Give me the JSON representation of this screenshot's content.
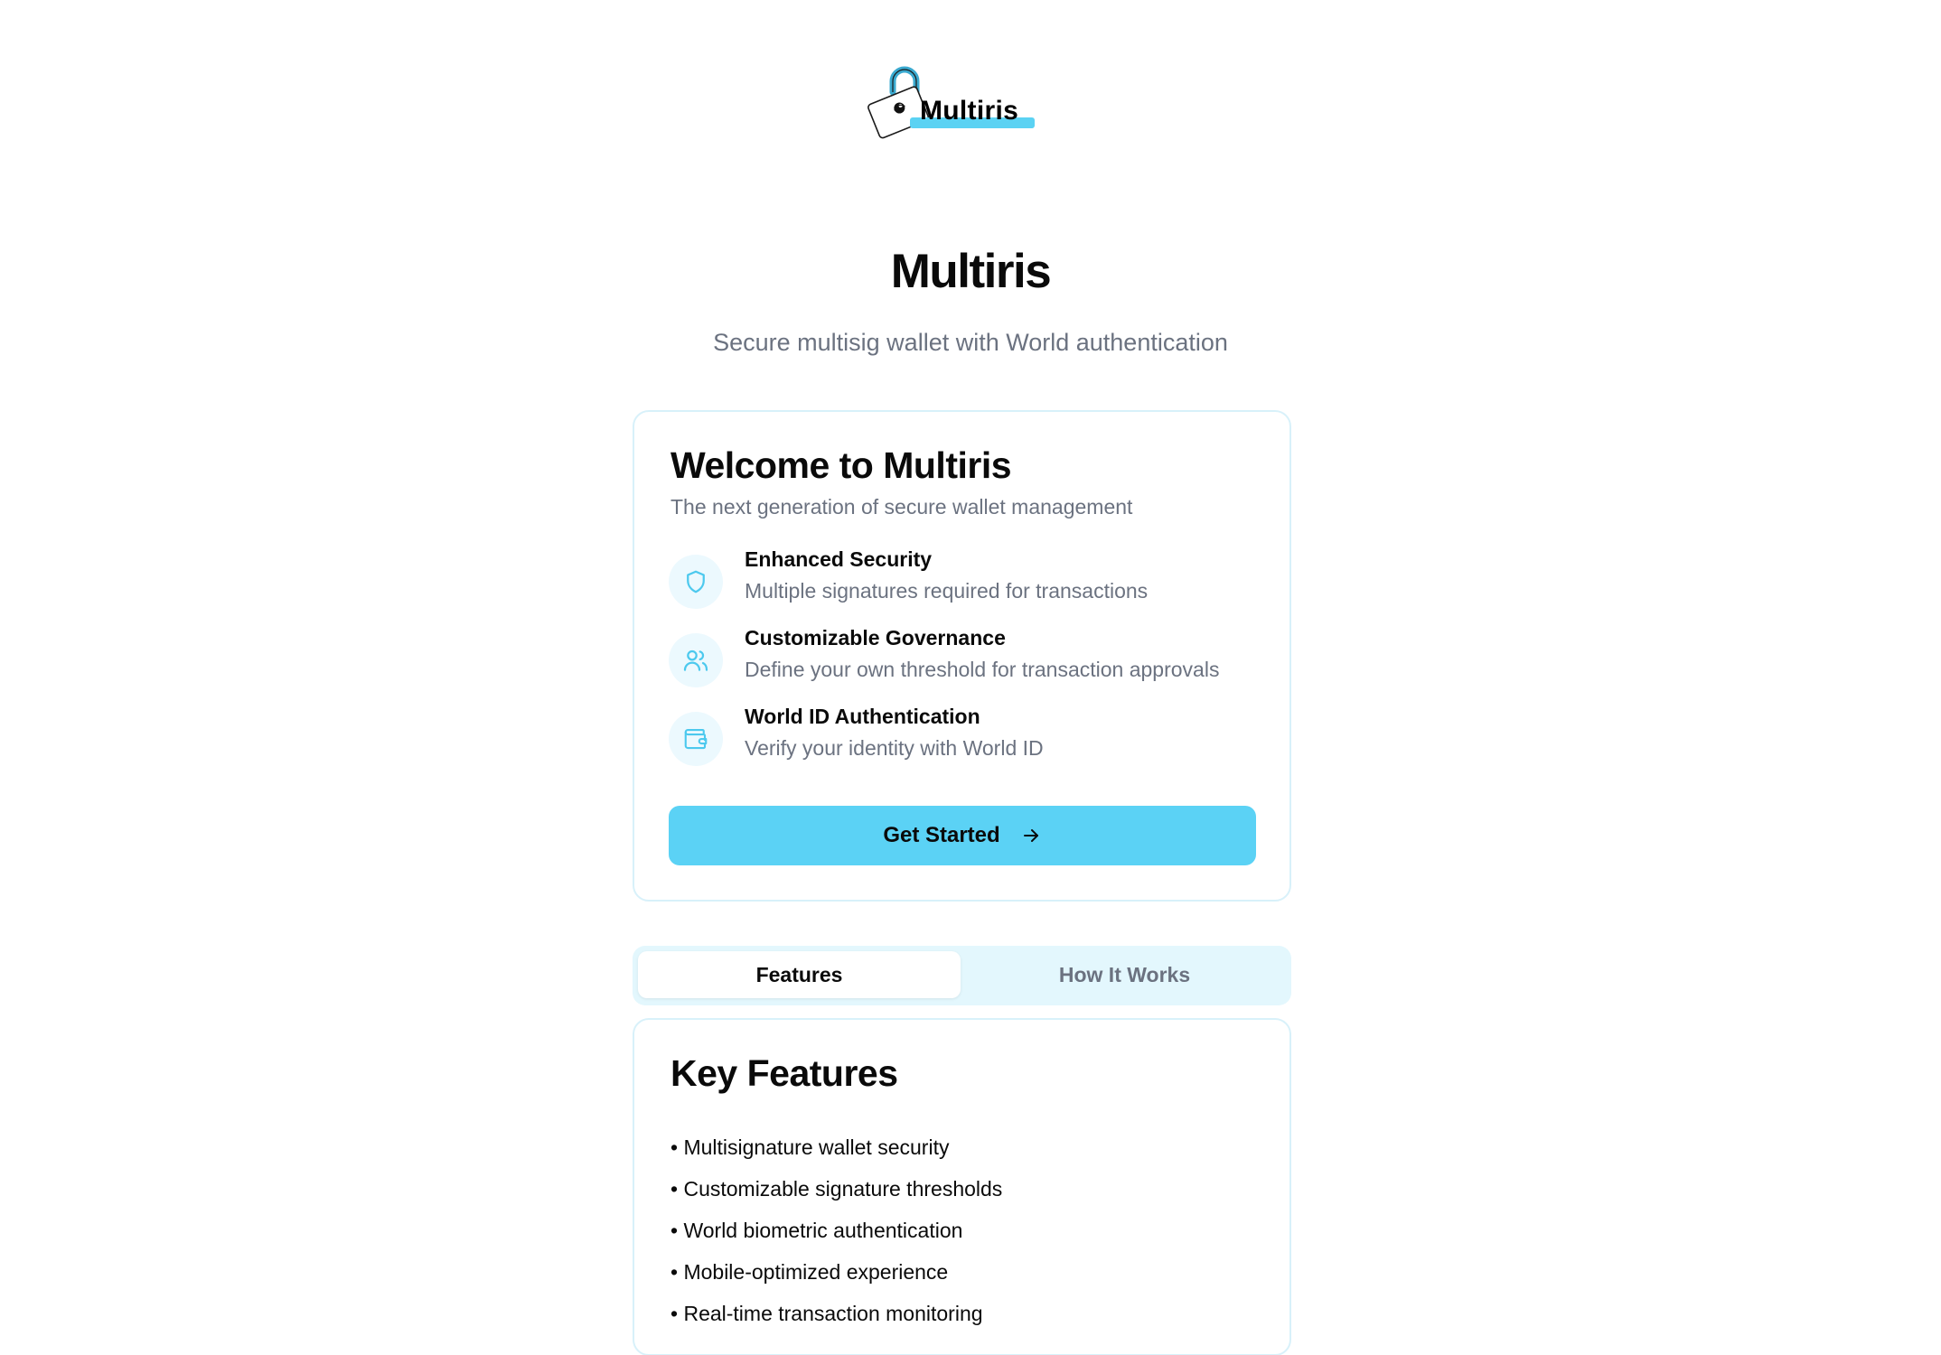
{
  "logo": {
    "text": "Multiris"
  },
  "header": {
    "title": "Multiris",
    "subtitle": "Secure multisig wallet with World authentication"
  },
  "welcome": {
    "title": "Welcome to Multiris",
    "subtitle": "The next generation of secure wallet management",
    "features": [
      {
        "icon": "shield-icon",
        "title": "Enhanced Security",
        "description": "Multiple signatures required for transactions"
      },
      {
        "icon": "users-icon",
        "title": "Customizable Governance",
        "description": "Define your own threshold for transaction approvals"
      },
      {
        "icon": "wallet-icon",
        "title": "World ID Authentication",
        "description": "Verify your identity with World ID"
      }
    ],
    "cta_label": "Get Started"
  },
  "tabs": [
    {
      "label": "Features",
      "active": true
    },
    {
      "label": "How It Works",
      "active": false
    }
  ],
  "key_features": {
    "title": "Key Features",
    "items": [
      "Multisignature wallet security",
      "Customizable signature thresholds",
      "World biometric authentication",
      "Mobile-optimized experience",
      "Real-time transaction monitoring"
    ]
  },
  "colors": {
    "accent": "#5bd2f5",
    "icon_stroke": "#4cc9ee",
    "muted_text": "#6b7280",
    "card_border": "#d8f1fa",
    "tab_bg": "#e3f7fd"
  }
}
